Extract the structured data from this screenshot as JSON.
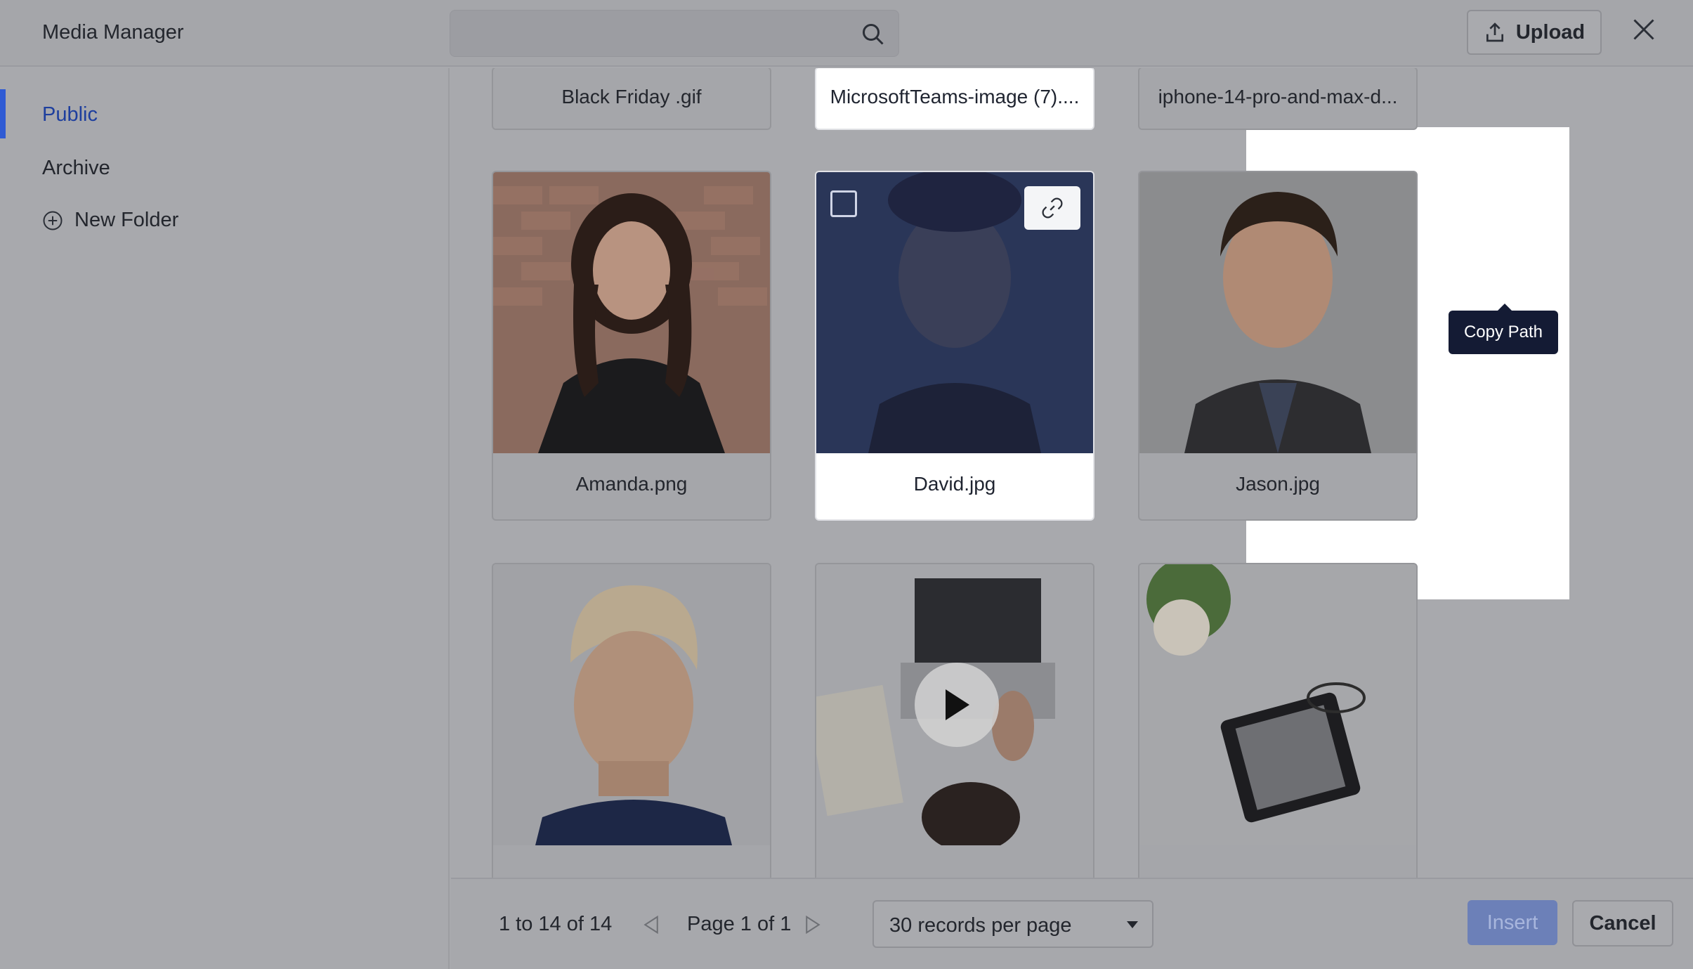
{
  "header": {
    "title": "Media Manager",
    "search_placeholder": "",
    "upload_label": "Upload"
  },
  "sidebar": {
    "items": [
      {
        "label": "Public",
        "active": true
      },
      {
        "label": "Archive",
        "active": false
      },
      {
        "label": "New Folder",
        "icon": "plus-circle-icon"
      }
    ]
  },
  "grid": {
    "top_row": [
      "Black Friday .gif",
      "MicrosoftTeams-image (7)....",
      "iphone-14-pro-and-max-d..."
    ],
    "middle_row": [
      "Amanda.png",
      "David.jpg",
      "Jason.jpg"
    ],
    "bottom_row_icons": [
      "portrait-image",
      "video-play-icon",
      "tablet-image"
    ],
    "tooltip": "Copy Path"
  },
  "footer": {
    "range": "1 to 14 of 14",
    "page": "Page 1 of 1",
    "per_page": "30 records per page",
    "insert_label": "Insert",
    "cancel_label": "Cancel"
  },
  "colors": {
    "accent": "#2f5bd4",
    "tooltip_bg": "#141b34",
    "insert_disabled": "#6c80b8"
  }
}
